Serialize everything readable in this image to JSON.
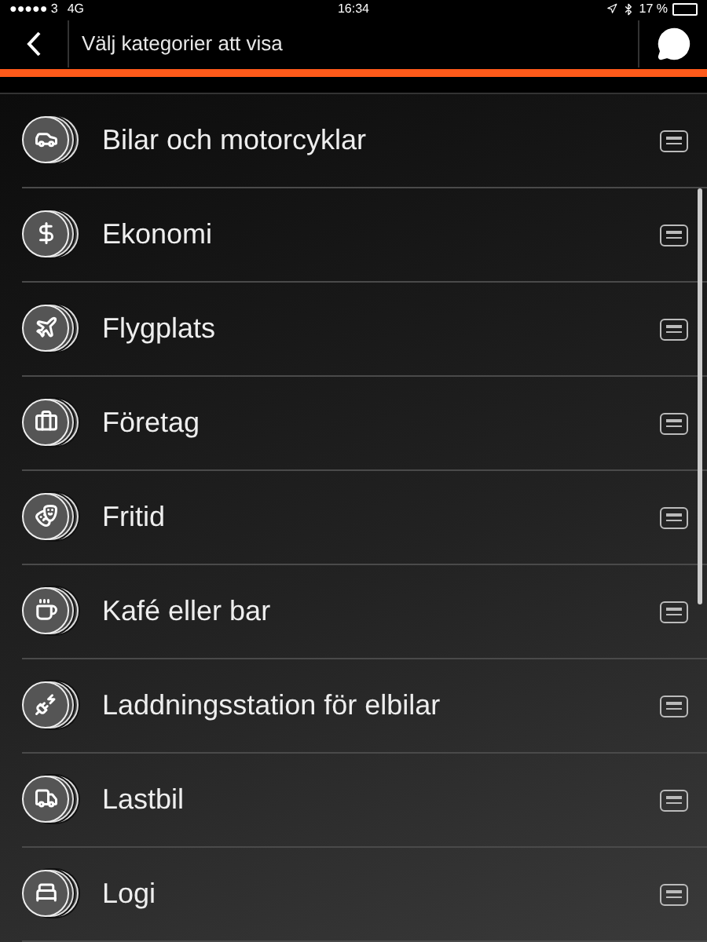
{
  "status_bar": {
    "carrier": "●●●●● 3",
    "network": "4G",
    "time": "16:34",
    "battery": "17 %"
  },
  "nav_bar": {
    "title": "Välj kategorier att visa"
  },
  "categories": [
    {
      "label": "Bilar och motorcyklar"
    },
    {
      "label": "Ekonomi"
    },
    {
      "label": "Flygplats"
    },
    {
      "label": "Företag"
    },
    {
      "label": "Fritid"
    },
    {
      "label": "Kafé eller bar"
    },
    {
      "label": "Laddningsstation för elbilar"
    },
    {
      "label": "Lastbil"
    },
    {
      "label": "Logi"
    }
  ]
}
